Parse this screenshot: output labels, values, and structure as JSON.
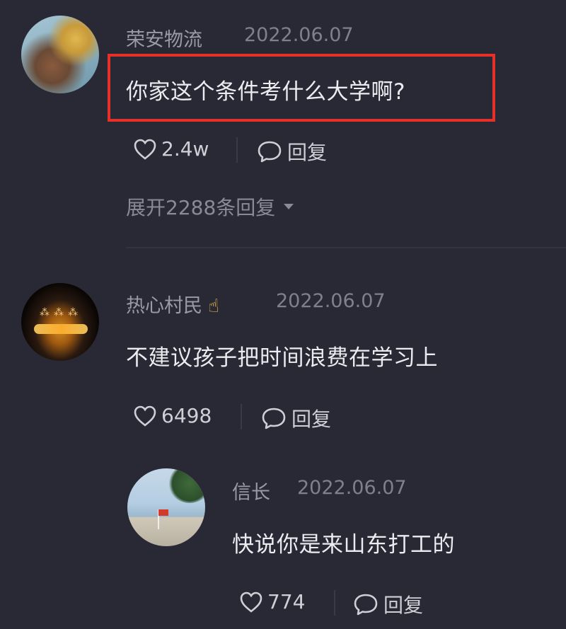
{
  "comments": [
    {
      "username": "荣安物流",
      "date": "2022.06.07",
      "text": "你家这个条件考什么大学啊?",
      "likes": "2.4w",
      "reply_label": "回复",
      "expand_label": "展开2288条回复"
    },
    {
      "username": "热心村民",
      "badge": "☝",
      "date": "2022.06.07",
      "text": "不建议孩子把时间浪费在学习上",
      "likes": "6498",
      "reply_label": "回复"
    },
    {
      "username": "信长",
      "date": "2022.06.07",
      "text": "快说你是来山东打工的",
      "likes": "774",
      "reply_label": "回复"
    }
  ],
  "colors": {
    "background": "#292935",
    "highlight_border": "#e8302a",
    "text_primary": "#ececf0",
    "text_secondary": "#9a9aa6"
  },
  "icons": {
    "like": "heart-icon",
    "reply": "chat-bubble-icon",
    "expand": "caret-down-icon"
  }
}
